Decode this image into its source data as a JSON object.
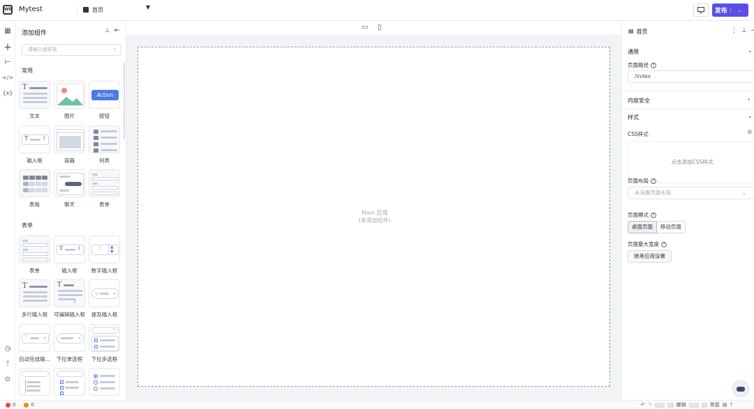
{
  "topbar": {
    "app_name": "Mytest",
    "page_name": "首页",
    "publish_label": "发布"
  },
  "left": {
    "title": "添加组件",
    "search_placeholder": "请输入组件名",
    "sections": [
      {
        "name": "常用",
        "items": [
          "文本",
          "图片",
          "按钮",
          "输入框",
          "容器",
          "列表",
          "表格",
          "聊天",
          "表单"
        ]
      },
      {
        "name": "表单",
        "items": [
          "表单",
          "输入框",
          "数字输入框",
          "多行输入框",
          "可编辑输入框",
          "提及输入框",
          "自动完成输...",
          "下拉单选框",
          "下拉多选框"
        ]
      }
    ],
    "action_text": "Action"
  },
  "canvas": {
    "main_label": "Main 区域",
    "main_sub": "(未添加组件)"
  },
  "right": {
    "page_title": "首页",
    "general": "通用",
    "path_label": "页面路径",
    "path_value": "/index",
    "security": "内容安全",
    "style": "样式",
    "css_label": "CSS样式",
    "css_add": "点击添加CSS样式",
    "layout_label": "页面布局",
    "layout_placeholder": "未设置页面布局",
    "mode_label": "页面模式",
    "mode_desktop": "桌面页面",
    "mode_mobile": "移动页面",
    "maxwidth_label": "页面最大宽度",
    "inherit": "继承应用设置"
  },
  "status": {
    "errors": "0",
    "warnings": "0",
    "undo": "撤销",
    "redo": "恢复",
    "ctrl": "Ctrl",
    "z": "Z",
    "y": "Y"
  },
  "colors": {
    "accent": "#5b4ee6",
    "canvas_bg": "#f2f3f5",
    "action_blue": "#4a7be8",
    "error": "#e5484d",
    "warning": "#f08a24"
  }
}
